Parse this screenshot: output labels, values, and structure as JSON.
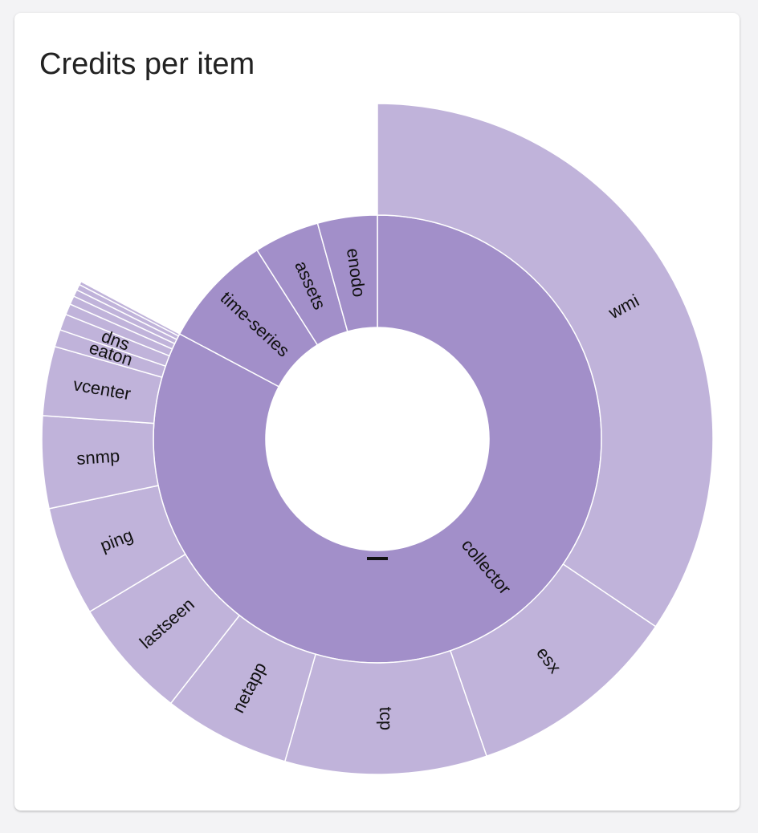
{
  "card": {
    "title": "Credits per item"
  },
  "center_label": "—",
  "chart_data": {
    "type": "sunburst",
    "title": "Credits per item",
    "colors": {
      "inner": "#a28fc9",
      "outer": "#c0b3da",
      "stroke": "#ffffff"
    },
    "units": "degrees of 360 (share of total credits)",
    "inner": [
      {
        "name": "collector",
        "start": 0.0,
        "end": 298.0,
        "children": [
          {
            "name": "wmi",
            "value": 124.0
          },
          {
            "name": "esx",
            "value": 37.0
          },
          {
            "name": "tcp",
            "value": 35.0
          },
          {
            "name": "netapp",
            "value": 22.0
          },
          {
            "name": "lastseen",
            "value": 21.0
          },
          {
            "name": "ping",
            "value": 19.0
          },
          {
            "name": "snmp",
            "value": 16.0
          },
          {
            "name": "vcenter",
            "value": 12.0
          },
          {
            "name": "eaton",
            "value": 3.0
          },
          {
            "name": "dns",
            "value": 2.8
          },
          {
            "name": "",
            "value": 1.9
          },
          {
            "name": "",
            "value": 1.5
          },
          {
            "name": "",
            "value": 1.2
          },
          {
            "name": "",
            "value": 1.0
          },
          {
            "name": "",
            "value": 0.6
          }
        ]
      },
      {
        "name": "time-series",
        "start": 298.0,
        "end": 327.5,
        "children": []
      },
      {
        "name": "assets",
        "start": 327.5,
        "end": 344.5,
        "children": []
      },
      {
        "name": "enodo",
        "start": 344.5,
        "end": 360.0,
        "children": []
      }
    ]
  }
}
